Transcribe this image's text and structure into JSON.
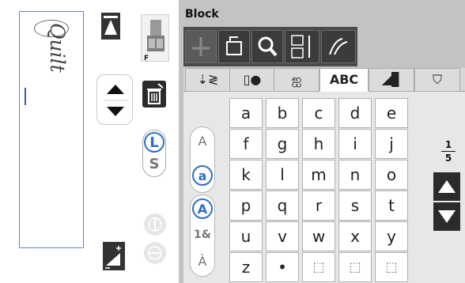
{
  "preview": {
    "text": "Quilt"
  },
  "panel_title": "Block",
  "toggles": {
    "size_large": "L",
    "size_small": "S"
  },
  "tabs": [
    {
      "label": "",
      "icon": "stitch-icon"
    },
    {
      "label": "",
      "icon": "block-icon"
    },
    {
      "label": "",
      "icon": "decorative-icon"
    },
    {
      "label": "ABC",
      "icon": ""
    },
    {
      "label": "",
      "icon": "satin-icon"
    },
    {
      "label": "",
      "icon": "shirt-icon"
    }
  ],
  "case_buttons": {
    "upper": "A",
    "lower": "a",
    "upper_alt": "A",
    "numbers": "1&",
    "accent": "À"
  },
  "keys": [
    [
      "a",
      "b",
      "c",
      "d",
      "e"
    ],
    [
      "f",
      "g",
      "h",
      "i",
      "j"
    ],
    [
      "k",
      "l",
      "m",
      "n",
      "o"
    ],
    [
      "p",
      "q",
      "r",
      "s",
      "t"
    ],
    [
      "u",
      "v",
      "w",
      "x",
      "y"
    ],
    [
      "z",
      "•",
      "⬚",
      "⬚",
      "⬚"
    ]
  ],
  "page": {
    "current": "1",
    "total": "5"
  },
  "colors": {
    "accent": "#2f6fc4",
    "dark": "#2b2b2b",
    "panel": "#c3c3c3"
  }
}
